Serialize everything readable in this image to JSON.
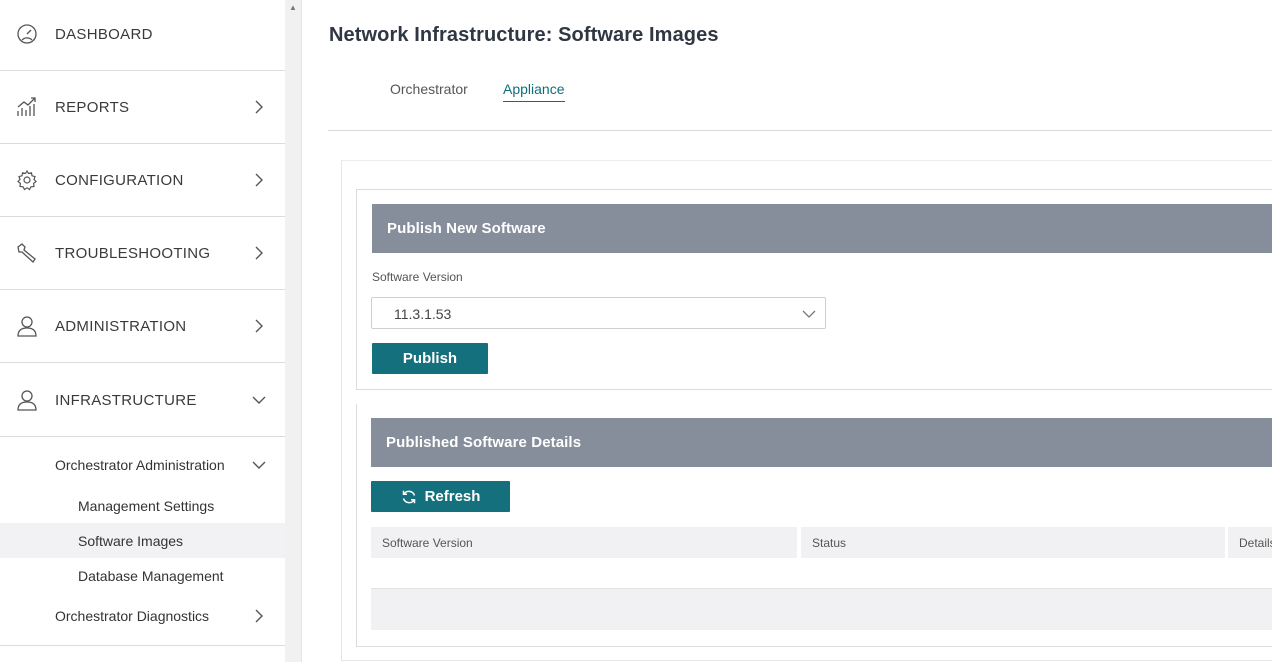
{
  "sidebar": {
    "items": [
      {
        "label": "DASHBOARD",
        "icon": "dashboard-gauge-icon"
      },
      {
        "label": "REPORTS",
        "icon": "reports-chart-icon"
      },
      {
        "label": "CONFIGURATION",
        "icon": "gear-icon"
      },
      {
        "label": "TROUBLESHOOTING",
        "icon": "wrench-icon"
      },
      {
        "label": "ADMINISTRATION",
        "icon": "user-icon"
      },
      {
        "label": "INFRASTRUCTURE",
        "icon": "user-icon"
      }
    ],
    "sub_group": {
      "label": "Orchestrator Administration"
    },
    "sub_items": [
      {
        "label": "Management Settings"
      },
      {
        "label": "Software Images"
      },
      {
        "label": "Database Management"
      }
    ],
    "diagnostics": {
      "label": "Orchestrator Diagnostics"
    },
    "active_item": "Software Images"
  },
  "page": {
    "title": "Network Infrastructure: Software Images",
    "tabs": [
      {
        "label": "Orchestrator"
      },
      {
        "label": "Appliance"
      }
    ],
    "active_tab": "Appliance"
  },
  "publish_card": {
    "header": "Publish New Software",
    "field_label": "Software Version",
    "selected_version": "11.3.1.53",
    "publish_button": "Publish"
  },
  "details_card": {
    "header": "Published Software Details",
    "refresh_button": "Refresh",
    "columns": [
      "Software Version",
      "Status",
      "Details"
    ]
  },
  "colors": {
    "accent": "#15707e",
    "card_header": "#868d9b",
    "active_tab": "#0f6e79"
  }
}
